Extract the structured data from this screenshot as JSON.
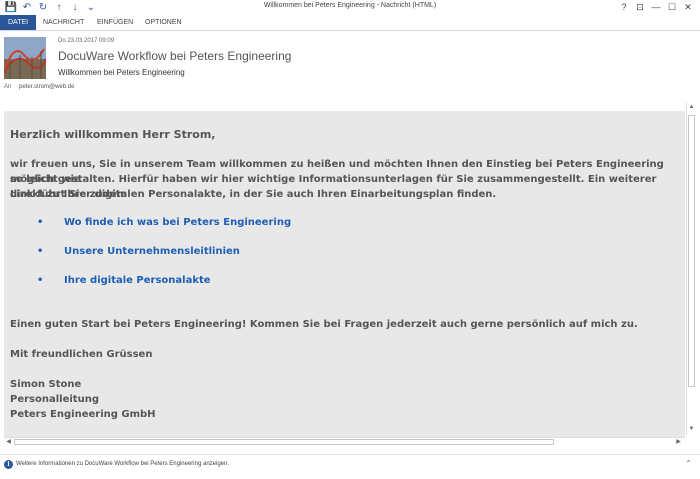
{
  "window": {
    "title": "Willkommen bei Peters Engineering - Nachricht (HTML)",
    "controls": {
      "help": "?",
      "restore_ribbon": "⊡",
      "minimize": "—",
      "maximize": "☐",
      "close": "✕"
    }
  },
  "qat": {
    "save": "💾",
    "undo": "↶",
    "redo": "↻",
    "up": "↑",
    "down": "↓",
    "more": "⌄"
  },
  "ribbon": {
    "tabs": [
      "DATEI",
      "NACHRICHT",
      "EINFÜGEN",
      "OPTIONEN"
    ],
    "active_tab": "DATEI"
  },
  "header": {
    "date": "Do 23.03.2017 09:09",
    "from": "DocuWare Workflow bei Peters Engineering",
    "subject": "Willkommen bei Peters Engineering",
    "to_label": "An",
    "to_value": "peter.strom@web.de"
  },
  "body": {
    "greeting": "Herzlich willkommen Herr Strom,",
    "intro_lines": [
      "wir freuen uns, Sie in unserem Team willkommen zu heißen und möchten Ihnen den Einstieg bei Peters Engineering so leicht wie",
      "möglich gestalten. Hierfür haben wir hier wichtige Informationsunterlagen für Sie zusammengestellt. Ein weiterer Link führt Sie zudem",
      "direkt zu Ihrer digitalen Personalakte, in der Sie auch Ihren Einarbeitungsplan finden."
    ],
    "bullet_char": "•",
    "links": [
      "Wo finde ich was bei Peters Engineering",
      "Unsere Unternehmensleitlinien",
      "Ihre digitale Personalakte"
    ],
    "closing": "Einen guten Start bei Peters Engineering! Kommen Sie bei Fragen jederzeit auch gerne persönlich auf mich zu.",
    "regards": "Mit freundlichen Grüssen",
    "signature": [
      "Simon Stone",
      "Personalleitung",
      "Peters Engineering GmbH"
    ]
  },
  "infobar": {
    "text": "Weitere Informationen zu DocuWare Workflow bei Peters Engineering anzeigen.",
    "icon": "info-icon"
  },
  "colors": {
    "accent": "#2b579a",
    "link": "#1f5fb3",
    "body_bg": "#e8e8e8"
  }
}
